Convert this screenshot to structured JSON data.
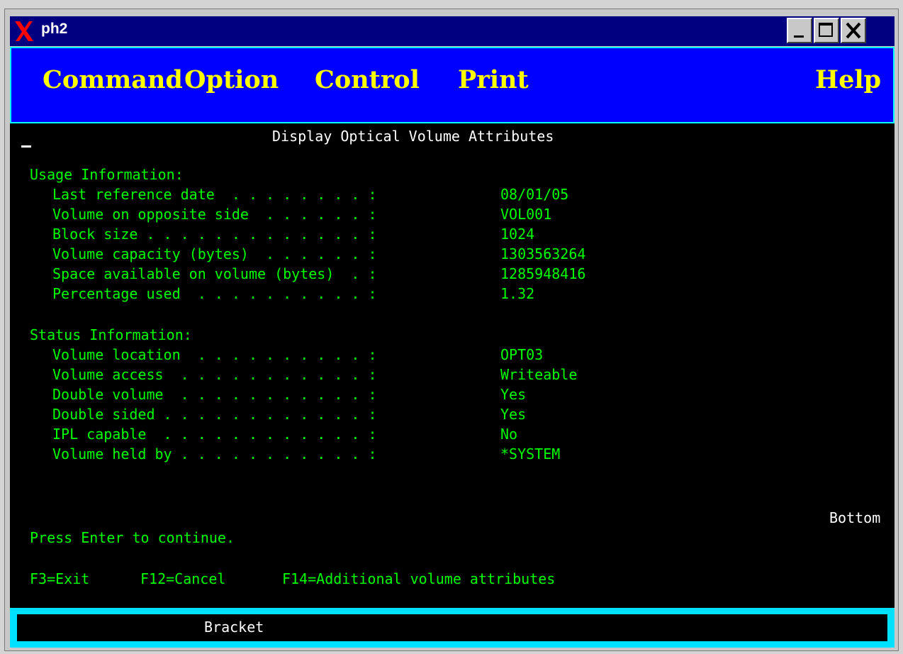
{
  "window": {
    "title": "ph2",
    "app_icon": "x-logo-icon",
    "controls": [
      "minimize-icon",
      "maximize-icon",
      "close-icon"
    ]
  },
  "menu": {
    "items": [
      "Command",
      "Option",
      "Control",
      "Print"
    ],
    "help": "Help"
  },
  "screen": {
    "title": "Display Optical Volume Attributes",
    "usage": {
      "header": "Usage Information:",
      "fields": [
        {
          "label": "Last reference date  . . . . . . . . :",
          "value": "08/01/05"
        },
        {
          "label": "Volume on opposite side  . . . . . . :",
          "value": "VOL001"
        },
        {
          "label": "Block size . . . . . . . . . . . . . :",
          "value": "1024"
        },
        {
          "label": "Volume capacity (bytes)  . . . . . . :",
          "value": "1303563264"
        },
        {
          "label": "Space available on volume (bytes)  . :",
          "value": "1285948416"
        },
        {
          "label": "Percentage used  . . . . . . . . . . :",
          "value": "1.32"
        }
      ]
    },
    "status": {
      "header": "Status Information:",
      "fields": [
        {
          "label": "Volume location  . . . . . . . . . . :",
          "value": "OPT03"
        },
        {
          "label": "Volume access  . . . . . . . . . . . :",
          "value": "Writeable"
        },
        {
          "label": "Double volume  . . . . . . . . . . . :",
          "value": "Yes"
        },
        {
          "label": "Double sided . . . . . . . . . . . . :",
          "value": "Yes"
        },
        {
          "label": "IPL capable  . . . . . . . . . . . . :",
          "value": "No"
        },
        {
          "label": "Volume held by . . . . . . . . . . . :",
          "value": "*SYSTEM"
        }
      ]
    },
    "bottom": "Bottom",
    "instruction": "Press Enter to continue.",
    "function_keys": [
      "F3=Exit",
      "F12=Cancel",
      "F14=Additional volume attributes"
    ]
  },
  "statusbar": {
    "text": "Bracket"
  },
  "colors": {
    "title_bar": "#000080",
    "menu_bg": "#0000ff",
    "menu_text": "#ffff00",
    "terminal_bg": "#000000",
    "terminal_text": "#00ff00",
    "status_border": "#00e0ff"
  }
}
